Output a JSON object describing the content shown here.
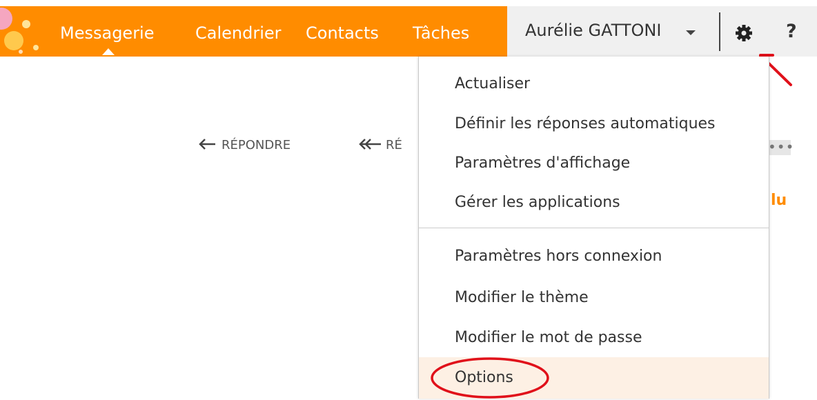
{
  "nav": {
    "items": [
      {
        "label": "Messagerie"
      },
      {
        "label": "Calendrier"
      },
      {
        "label": "Contacts"
      },
      {
        "label": "Tâches"
      }
    ],
    "active": "Messagerie"
  },
  "user": {
    "name": "Aurélie GATTONI"
  },
  "header_icons": {
    "settings": "gear-icon",
    "help": "?"
  },
  "toolbar": {
    "reply_label": "RÉPONDRE",
    "reply_all_label": "RÉ",
    "more_label": "•••",
    "status_fragment": "lu"
  },
  "settings_menu": {
    "group1": [
      {
        "label": "Actualiser"
      },
      {
        "label": "Définir les réponses automatiques"
      },
      {
        "label": "Paramètres d'affichage"
      },
      {
        "label": "Gérer les applications"
      }
    ],
    "group2": [
      {
        "label": "Paramètres hors connexion"
      },
      {
        "label": "Modifier le thème"
      },
      {
        "label": "Modifier le mot de passe"
      },
      {
        "label": "Options"
      }
    ],
    "highlighted": "Options"
  },
  "colors": {
    "brand_orange": "#ff8c00",
    "annotation_red": "#e0101a",
    "hover_bg": "#fdf0e4"
  }
}
